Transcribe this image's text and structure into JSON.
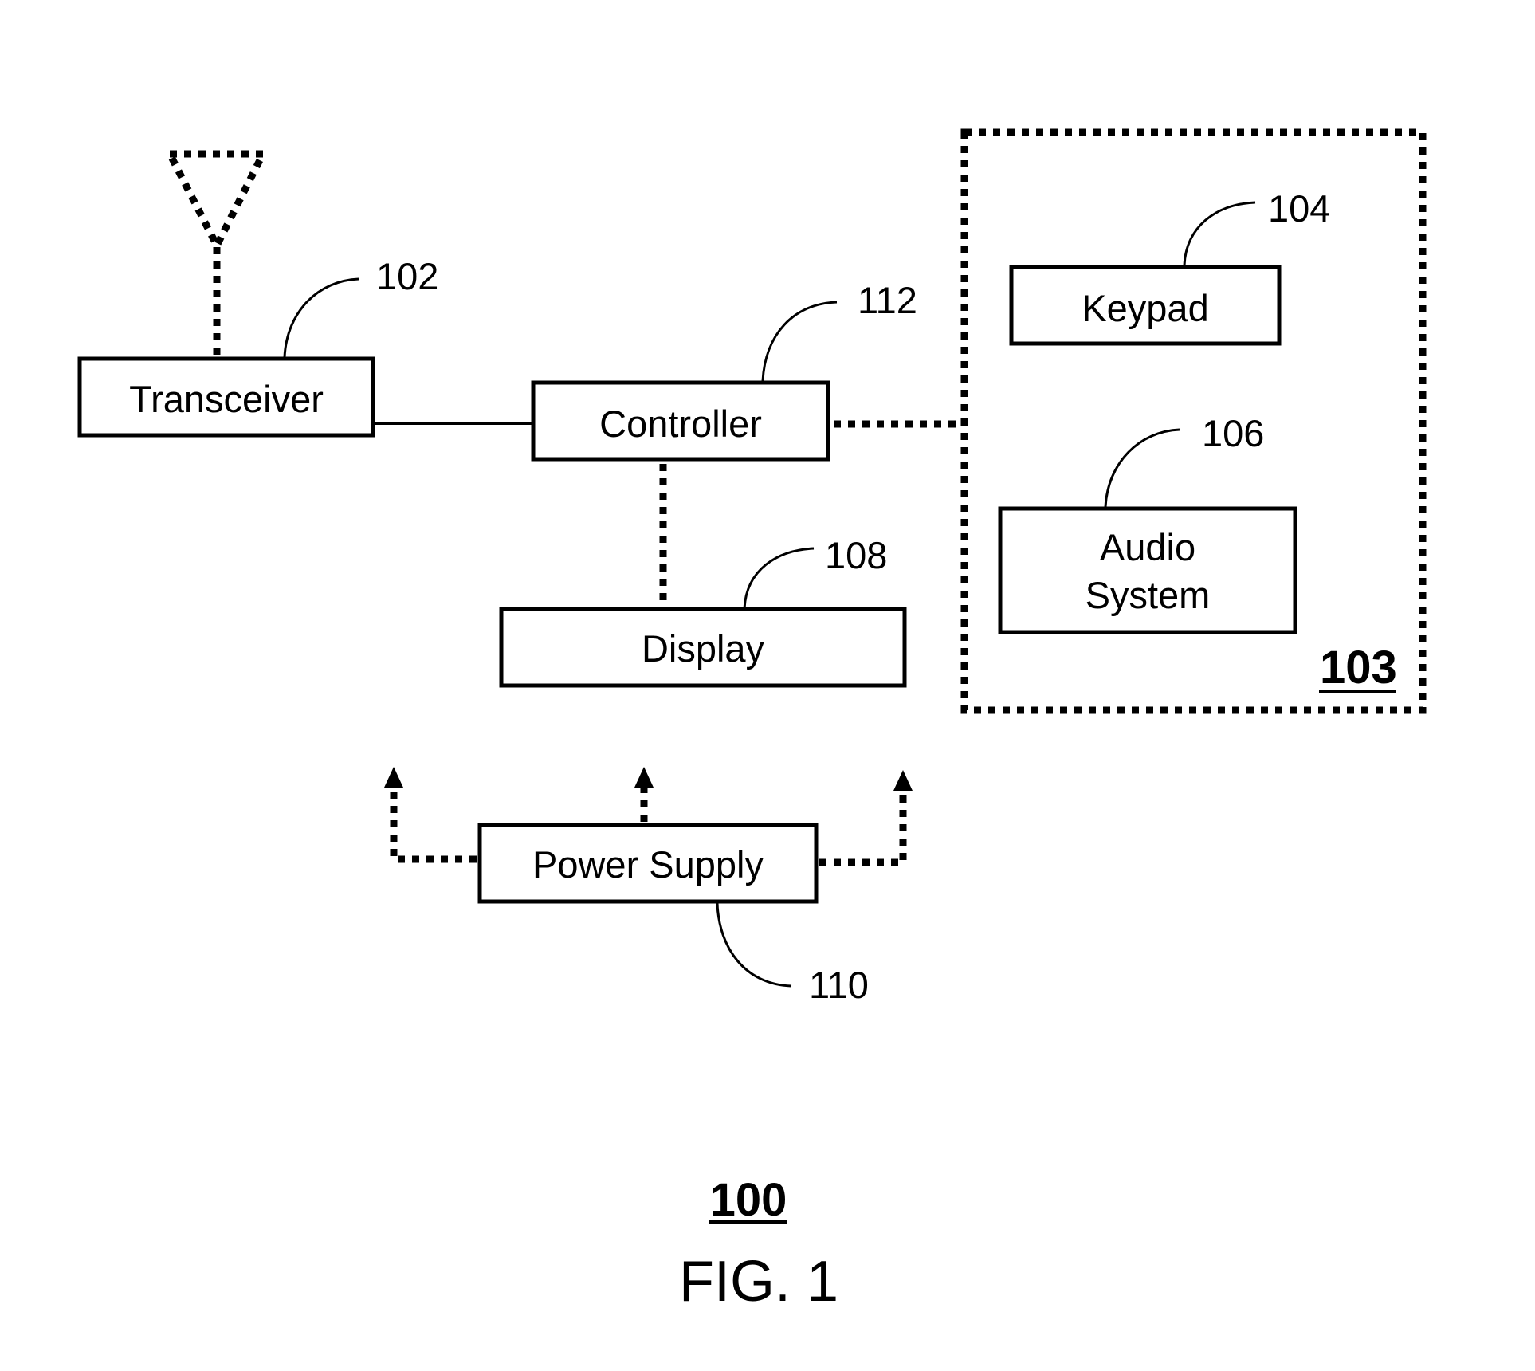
{
  "figure": {
    "number_label": "100",
    "caption": "FIG. 1"
  },
  "blocks": {
    "transceiver": {
      "label": "Transceiver",
      "ref": "102"
    },
    "controller": {
      "label": "Controller",
      "ref": "112"
    },
    "display": {
      "label": "Display",
      "ref": "108"
    },
    "power_supply": {
      "label": "Power Supply",
      "ref": "110"
    },
    "keypad": {
      "label": "Keypad",
      "ref": "104"
    },
    "audio_system": {
      "label_line1": "Audio",
      "label_line2": "System",
      "ref": "106"
    }
  },
  "user_interface_group": {
    "ref": "103"
  },
  "connections": [
    {
      "from": "antenna",
      "to": "transceiver",
      "style": "dotted"
    },
    {
      "from": "transceiver",
      "to": "controller",
      "style": "solid"
    },
    {
      "from": "controller",
      "to": "user_interface_group",
      "style": "dotted"
    },
    {
      "from": "controller",
      "to": "display",
      "style": "dotted"
    },
    {
      "from": "power_supply",
      "to": "left",
      "style": "dotted-arrow"
    },
    {
      "from": "power_supply",
      "to": "up",
      "style": "dotted-arrow"
    },
    {
      "from": "power_supply",
      "to": "right",
      "style": "dotted-arrow"
    }
  ]
}
